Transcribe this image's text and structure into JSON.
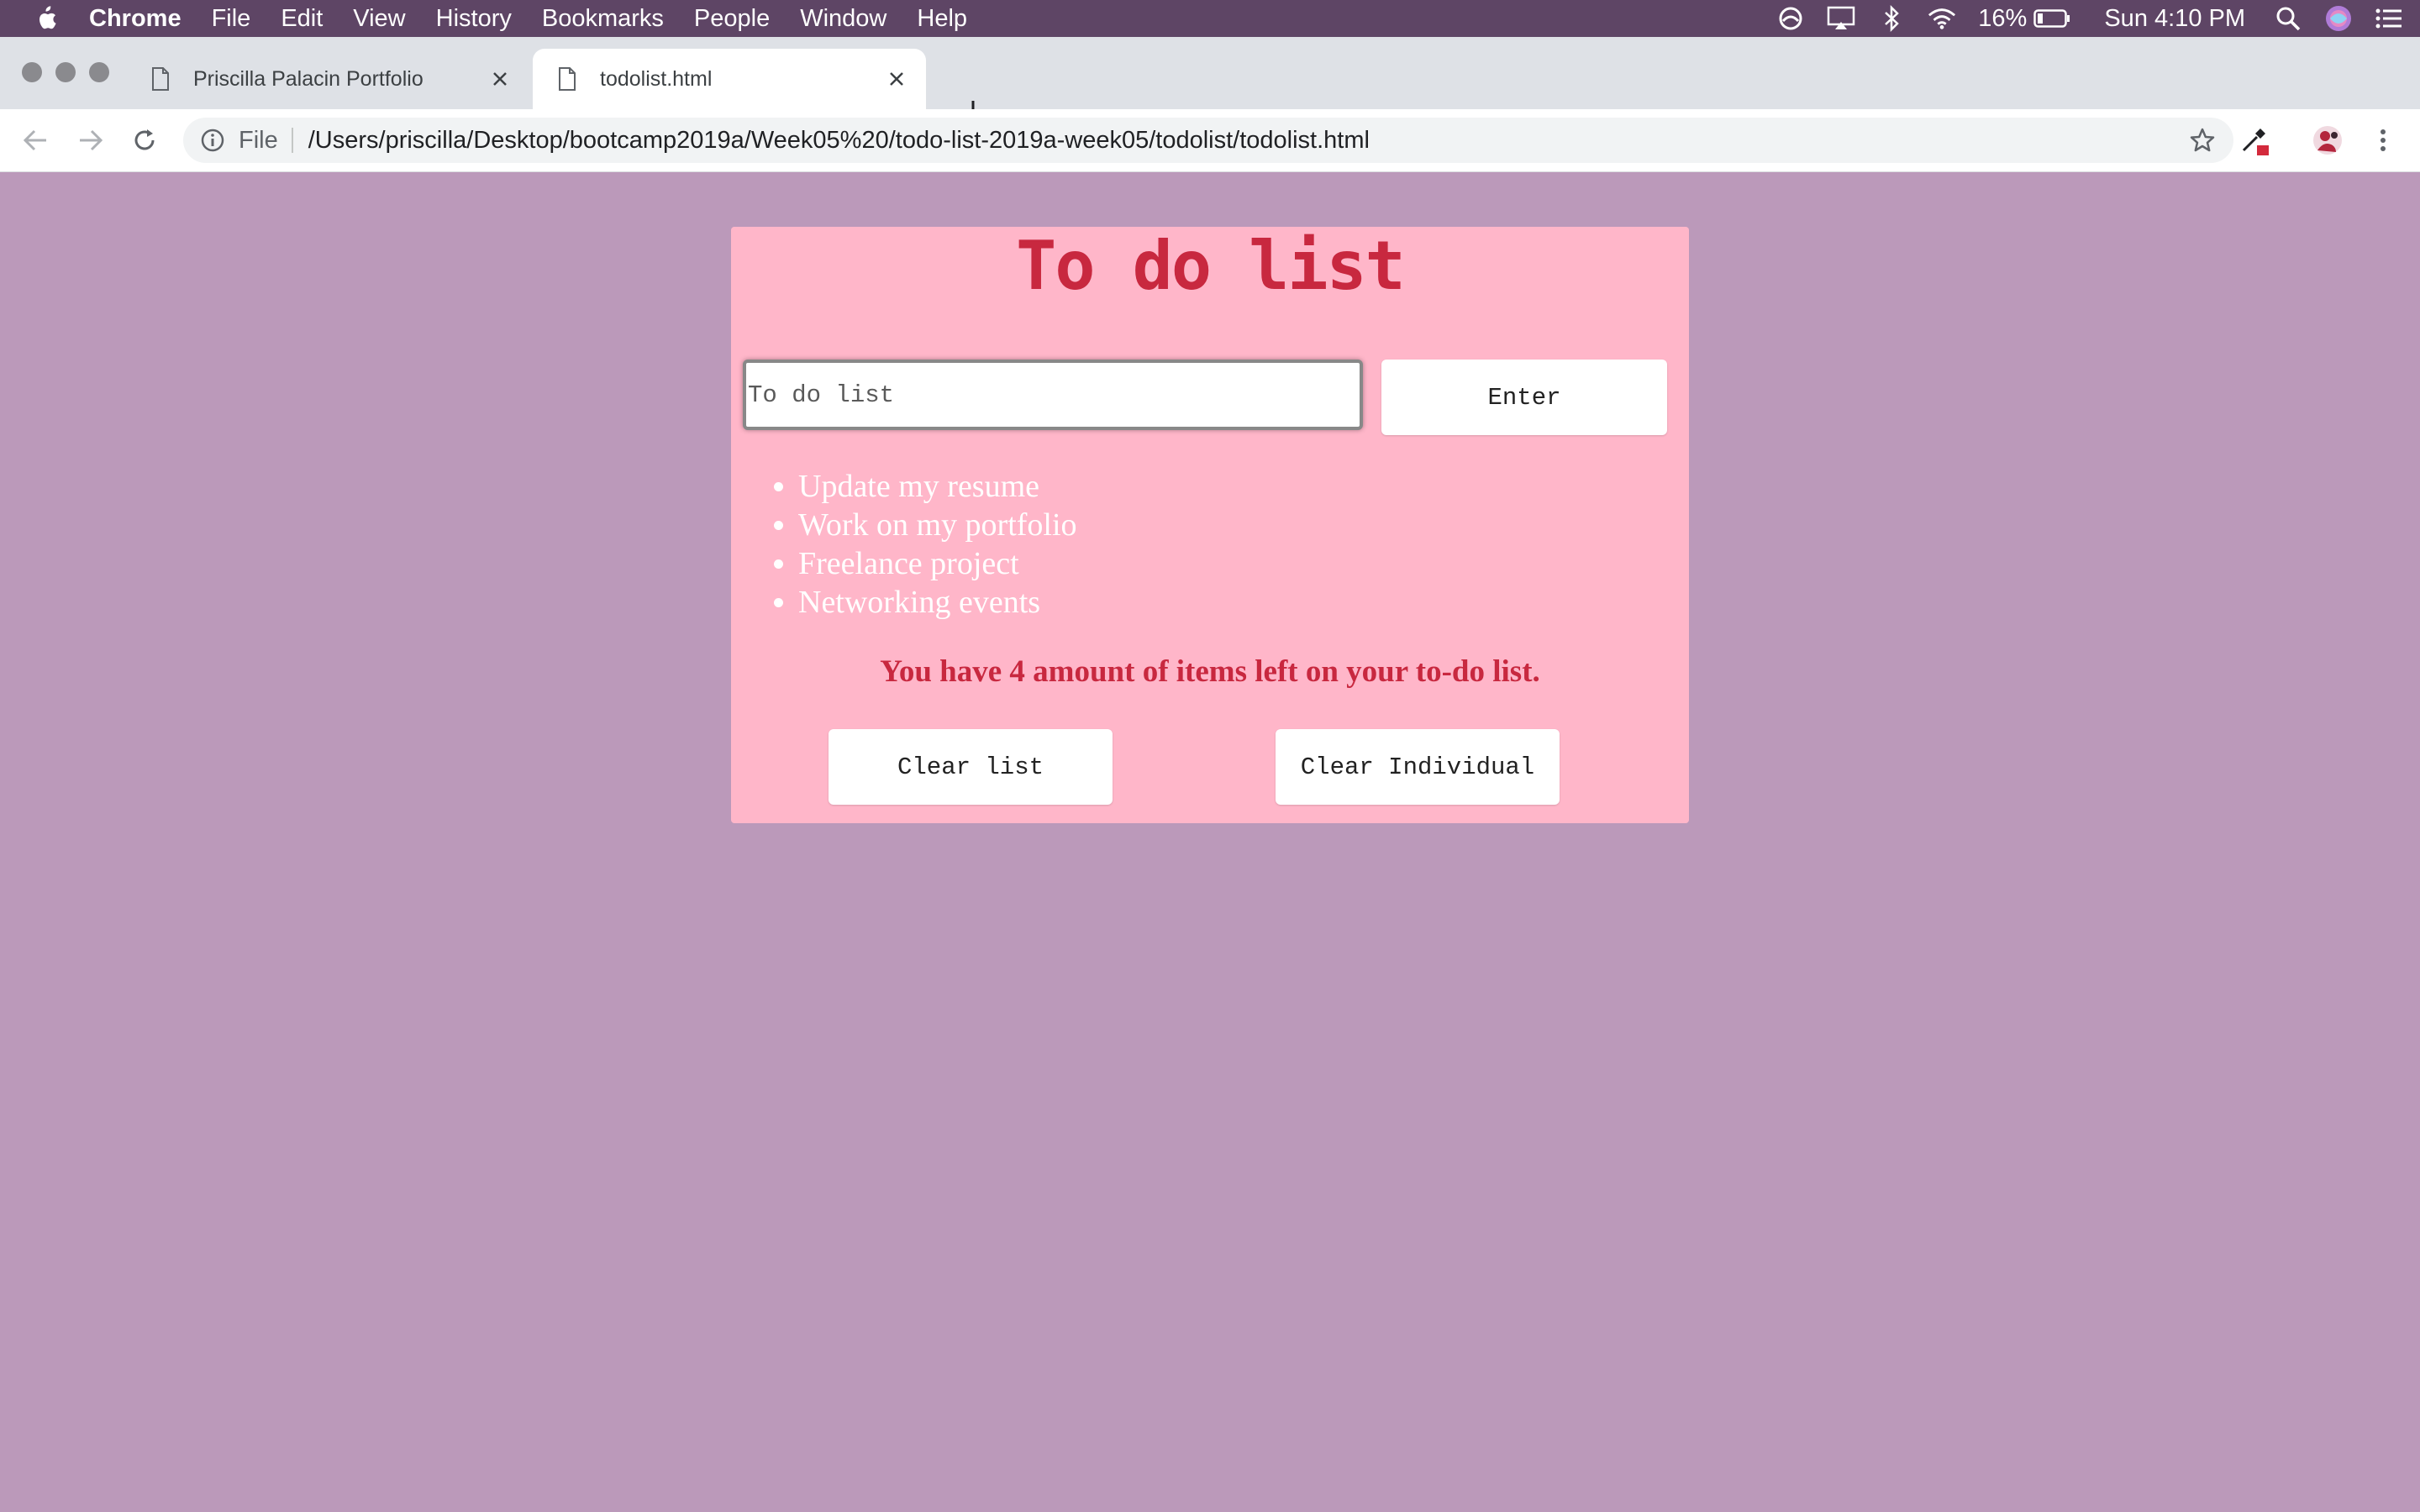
{
  "menubar": {
    "app_name": "Chrome",
    "items": [
      "File",
      "Edit",
      "View",
      "History",
      "Bookmarks",
      "People",
      "Window",
      "Help"
    ],
    "battery": "16%",
    "clock": "Sun 4:10 PM"
  },
  "tabs": [
    {
      "title": "Priscilla Palacin Portfolio",
      "active": false
    },
    {
      "title": "todolist.html",
      "active": true
    }
  ],
  "address_bar": {
    "scheme_label": "File",
    "url": "/Users/priscilla/Desktop/bootcamp2019a/Week05%20/todo-list-2019a-week05/todolist/todolist.html"
  },
  "page": {
    "title": "To do list",
    "input": {
      "value": "",
      "placeholder": "To do list"
    },
    "enter_label": "Enter",
    "items": [
      "Update my resume",
      "Work on my portfolio",
      "Freelance project",
      "Networking events"
    ],
    "count_text": "You have 4 amount of items left on your to-do list.",
    "clear_list_label": "Clear list",
    "clear_individual_label": "Clear Individual"
  },
  "colors": {
    "page_background": "#bb99ba",
    "card_background": "#ffb6c9",
    "accent_red": "#c8283f",
    "menubar": "#5e4565"
  }
}
